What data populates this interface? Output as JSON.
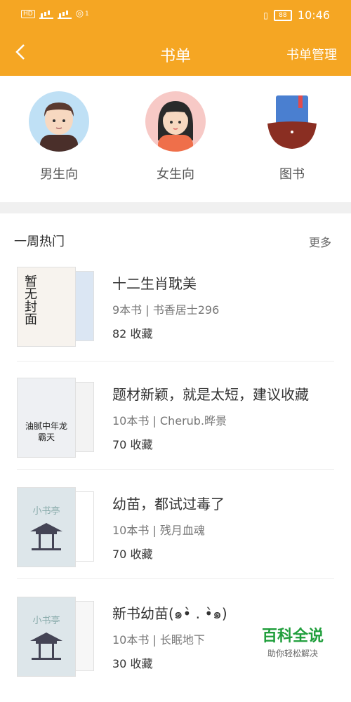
{
  "status": {
    "left_icons": [
      "hd-icon",
      "4g-signal-icon",
      "4g-signal-icon",
      "hotspot-icon"
    ],
    "hotspot_count": "1",
    "battery": "88",
    "time": "10:46"
  },
  "header": {
    "title": "书单",
    "manage_label": "书单管理"
  },
  "categories": [
    {
      "label": "男生向",
      "icon": "male-avatar-icon"
    },
    {
      "label": "女生向",
      "icon": "female-avatar-icon"
    },
    {
      "label": "图书",
      "icon": "book-icon"
    }
  ],
  "section": {
    "title": "一周热门",
    "more": "更多"
  },
  "items": [
    {
      "title": "十二生肖耽美",
      "meta": "9本书 | 书香居士296",
      "fav": "82 收藏",
      "cover_text": "暂无封面",
      "cover_color": "#f7f3ee"
    },
    {
      "title": "题材新颖，就是太短，建议收藏",
      "meta": "10本书 | Cherub.晔景",
      "fav": "70 收藏",
      "cover_text": "油腻中年龙霸天",
      "cover_color": "#eef0f3"
    },
    {
      "title": "幼苗，都试过毒了",
      "meta": "10本书 | 残月血魂",
      "fav": "70 收藏",
      "cover_text": "小书亭",
      "cover_color": "#dde6ea"
    },
    {
      "title": "新书幼苗(๑•̀ . •̀๑)",
      "meta": "10本书 | 长眠地下",
      "fav": "30 收藏",
      "cover_text": "小书亭",
      "cover_color": "#dde6ea"
    }
  ],
  "watermark": {
    "title": "百科全说",
    "subtitle": "助你轻松解决"
  },
  "colors": {
    "accent": "#f5a623",
    "watermark_green": "#1f9e3b"
  }
}
